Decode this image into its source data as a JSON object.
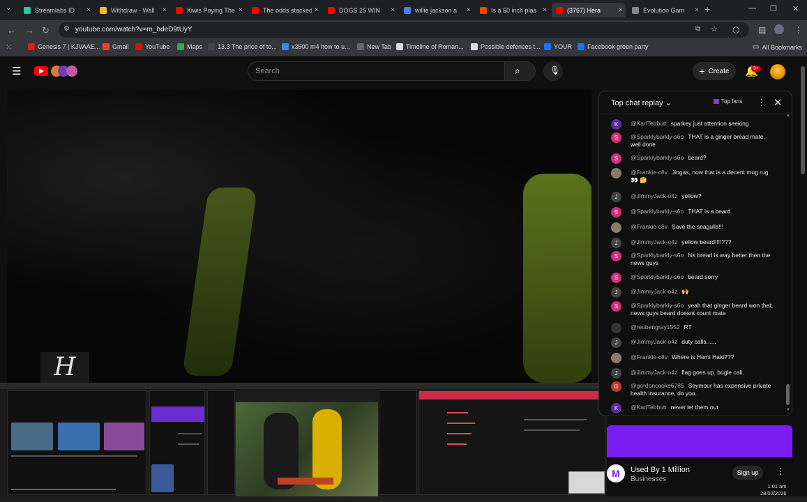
{
  "browser": {
    "tabs": [
      {
        "title": "Streamlabs ID",
        "color": "#31c3a2"
      },
      {
        "title": "Withdraw - Wall",
        "color": "#f3ba2f"
      },
      {
        "title": "Kiwis Paying The",
        "color": "#ff0000"
      },
      {
        "title": "The odds stacked",
        "color": "#ff0000"
      },
      {
        "title": "DOGS 25 WIN",
        "color": "#ff0000"
      },
      {
        "title": "willie jackson a",
        "color": "#4285f4"
      },
      {
        "title": "Is a 50 inch plas",
        "color": "#ff4500"
      },
      {
        "title": "(3767) Hera",
        "color": "#ff0000"
      },
      {
        "title": "Evolution Gam",
        "color": "#888888"
      }
    ],
    "new_tab": "+",
    "url": "youtube.com/watch?v=m_hdeD9tUyY",
    "bookmarks": [
      {
        "label": "Genesis 7 | KJVAAE...",
        "color": "#cc2222"
      },
      {
        "label": "Gmail",
        "color": "#ea4335"
      },
      {
        "label": "YouTube",
        "color": "#ff0000"
      },
      {
        "label": "Maps",
        "color": "#34a853"
      },
      {
        "label": "13.3 The price of to...",
        "color": "#444444"
      },
      {
        "label": "x3500 m4 how to u...",
        "color": "#4285f4"
      },
      {
        "label": "New Tab",
        "color": "#666666"
      },
      {
        "label": "Timeline of Roman...",
        "color": "#dddddd"
      },
      {
        "label": "Possible defences t...",
        "color": "#dddddd"
      },
      {
        "label": "YOUR",
        "color": "#1877f2"
      },
      {
        "label": "Facebook green party",
        "color": "#1877f2"
      }
    ],
    "all_bookmarks": "All Bookmarks"
  },
  "youtube": {
    "search_placeholder": "Search",
    "create_label": "Create",
    "notif_count": "9+"
  },
  "video": {
    "watermark": "H"
  },
  "chat": {
    "title": "Top chat replay",
    "top_fans": "Top fans",
    "messages": [
      {
        "initial": "K",
        "color": "#5a2ca0",
        "author": "@KarlTebbutt",
        "text": "sparkey just attention seeking"
      },
      {
        "initial": "S",
        "color": "#d0307a",
        "author": "@Sparklybarkly-s6o",
        "text": "THAT is a ginger bread mate, well done"
      },
      {
        "initial": "S",
        "color": "#d0307a",
        "author": "@Sparklybarkly-s6o",
        "text": "beard?"
      },
      {
        "initial": "",
        "color": "#8a7a6a",
        "author": "@Frankie-c8v",
        "text": "Jingas, now that is a decent mug rug 👀 🤔"
      },
      {
        "initial": "J",
        "color": "#444444",
        "author": "@JimmyJack-o4z",
        "text": "yellow?"
      },
      {
        "initial": "S",
        "color": "#d0307a",
        "author": "@Sparklybarkly-s6o",
        "text": "THAT is a beard"
      },
      {
        "initial": "",
        "color": "#8a7a6a",
        "author": "@Frankie-c8v",
        "text": "Save the seagulls!!!"
      },
      {
        "initial": "J",
        "color": "#444444",
        "author": "@JimmyJack-o4z",
        "text": "yellow beard!!!!???"
      },
      {
        "initial": "S",
        "color": "#d0307a",
        "author": "@Sparklybarkly-s6o",
        "text": "his bread is way better then the news guys"
      },
      {
        "initial": "S",
        "color": "#d0307a",
        "author": "@Sparklybarkly-s6o",
        "text": "beard sorry"
      },
      {
        "initial": "J",
        "color": "#444444",
        "author": "@JimmyJack-o4z",
        "text": "🙌"
      },
      {
        "initial": "S",
        "color": "#d0307a",
        "author": "@Sparklybarkly-s6o",
        "text": "yeah that ginger beard won that, news guys beard doesnt count mate"
      },
      {
        "initial": "",
        "color": "#333333",
        "author": "@reubengray1552",
        "text": "RT"
      },
      {
        "initial": "J",
        "color": "#444444",
        "author": "@JimmyJack-o4z",
        "text": "duty calls......"
      },
      {
        "initial": "",
        "color": "#8a7a6a",
        "author": "@Frankie-c8v",
        "text": "Where is Hemi Haki???"
      },
      {
        "initial": "J",
        "color": "#444444",
        "author": "@JimmyJack-o4z",
        "text": "flag goes up. bugle call."
      },
      {
        "initial": "G",
        "color": "#c0392b",
        "author": "@gordoncooke6785",
        "text": "Seymour has expensive private health insurance, do you."
      },
      {
        "initial": "K",
        "color": "#5a2ca0",
        "author": "@KarlTebbutt",
        "text": "never let them out"
      }
    ]
  },
  "ad": {
    "logo": "M",
    "title": "Used By 1 Million",
    "subtitle": "Businesses",
    "cta": "Sign up"
  },
  "system": {
    "time": "1:01 am",
    "date": "28/02/2026"
  }
}
